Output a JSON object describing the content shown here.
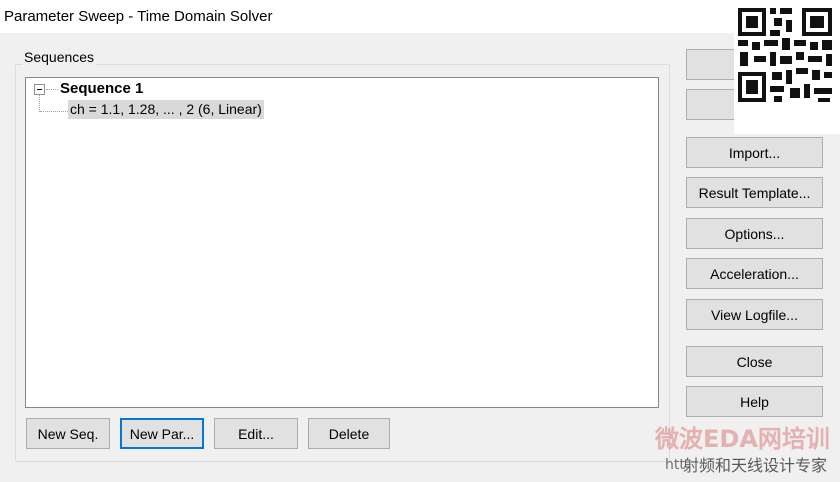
{
  "window": {
    "title": "Parameter Sweep - Time Domain Solver"
  },
  "sequences": {
    "group_label": "Sequences",
    "tree": {
      "sequence_label": "Sequence 1",
      "parameter_label": "ch = 1.1, 1.28, ... , 2 (6, Linear)"
    }
  },
  "bottom_buttons": {
    "new_seq": "New Seq.",
    "new_par": "New Par...",
    "edit": "Edit...",
    "delete": "Delete"
  },
  "side_buttons": {
    "import": "Import...",
    "result_template": "Result Template...",
    "options": "Options...",
    "acceleration": "Acceleration...",
    "view_logfile": "View Logfile...",
    "close": "Close",
    "help": "Help"
  },
  "watermark": {
    "line1": "微波EDA网培训",
    "line2": "射频和天线设计专家",
    "prefix": "htt"
  }
}
